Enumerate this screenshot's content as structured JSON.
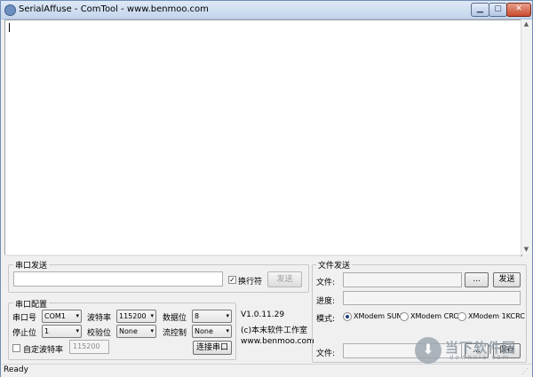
{
  "window": {
    "title": "SerialAffuse - ComTool - www.benmoo.com",
    "min_glyph": "▁",
    "max_glyph": "▢",
    "close_glyph": "✕"
  },
  "send": {
    "group_title": "串口发送",
    "input_value": "",
    "newline_label": "换行符",
    "newline_checked": true,
    "send_button": "发送"
  },
  "config": {
    "group_title": "串口配置",
    "port_label": "串口号",
    "port_value": "COM1",
    "baud_label": "波特率",
    "baud_value": "115200",
    "databits_label": "数据位",
    "databits_value": "8",
    "stopbits_label": "停止位",
    "stopbits_value": "1",
    "parity_label": "校验位",
    "parity_value": "None",
    "flow_label": "流控制",
    "flow_value": "None",
    "custom_baud_label": "自定波特率",
    "custom_baud_checked": false,
    "custom_baud_value": "115200",
    "connect_button": "连接串口"
  },
  "info": {
    "version": "V1.0.11.29",
    "copyright": "(c)本末软件工作室",
    "website": "www.benmoo.com"
  },
  "file_send": {
    "group_title": "文件发送",
    "file_label": "文件:",
    "browse_button": "...",
    "send_button": "发送",
    "progress_label": "进度:",
    "progress": 0,
    "mode_label": "模式:",
    "modes": [
      "XModem SUM",
      "XModem CRC",
      "XModem 1KCRC"
    ],
    "mode_selected": 0
  },
  "file_save": {
    "file_label": "文件:",
    "browse_button": "...",
    "save_button": "保存"
  },
  "status": {
    "text": "Ready"
  },
  "watermark": {
    "text": "当下软件园",
    "sub": "downxia.com",
    "icon": "download-icon",
    "arrow_glyph": "⬇"
  },
  "glyphs": {
    "dropdown": "▾",
    "check": "✓",
    "scroll_up": "▲",
    "scroll_down": "▼",
    "grip": "⋰"
  }
}
